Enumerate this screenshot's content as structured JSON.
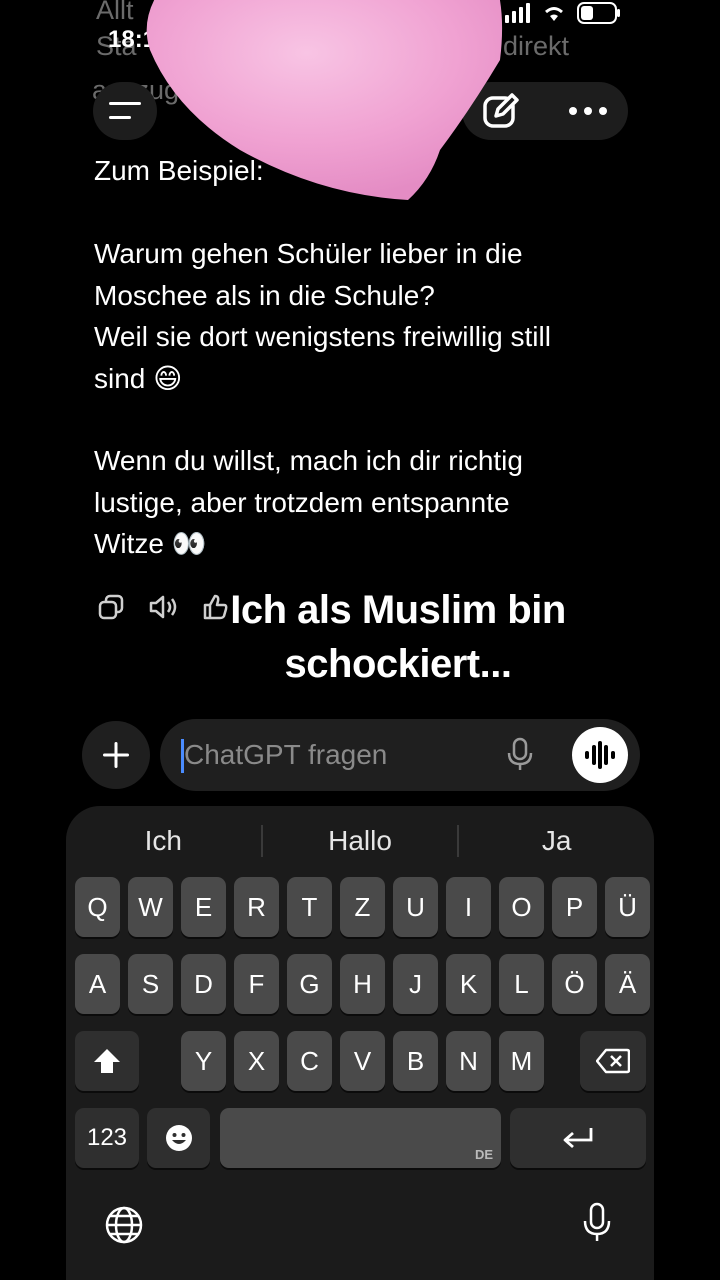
{
  "faded_text": {
    "line1": "Allt",
    "line2_left": "Sta",
    "line2_right": "direkt",
    "line3": "auszugre"
  },
  "status_bar": {
    "time": "18:1"
  },
  "header": {
    "menu_icon": "hamburger-icon",
    "edit_icon": "compose-icon",
    "more_icon": "more-dots-icon"
  },
  "message": {
    "intro": "Zum Beispiel:",
    "joke_lines": [
      "Warum gehen Schüler lieber in die",
      "Moschee als in die Schule?",
      "Weil sie dort wenigstens freiwillig still",
      "sind 😄"
    ],
    "offer_lines": [
      "Wenn du willst, mach ich dir richtig",
      "lustige, aber trotzdem entspannte",
      "Witze 👀"
    ]
  },
  "overlay_caption": {
    "line1": "Ich als Muslim bin",
    "line2": "schockiert..."
  },
  "composer": {
    "placeholder": "ChatGPT fragen"
  },
  "keyboard": {
    "suggestions": [
      "Ich",
      "Hallo",
      "Ja"
    ],
    "row1": [
      "Q",
      "W",
      "E",
      "R",
      "T",
      "Z",
      "U",
      "I",
      "O",
      "P",
      "Ü"
    ],
    "row2": [
      "A",
      "S",
      "D",
      "F",
      "G",
      "H",
      "J",
      "K",
      "L",
      "Ö",
      "Ä"
    ],
    "row3": [
      "Y",
      "X",
      "C",
      "V",
      "B",
      "N",
      "M"
    ],
    "numbers_label": "123",
    "space_sublabel": "DE"
  },
  "colors": {
    "background": "#000000",
    "pill": "#1d1d1d",
    "key": "#4a4a4a",
    "key_dark": "#2f2f2f",
    "petal_pink": "#f2a6d6",
    "cursor": "#4a8cff"
  }
}
